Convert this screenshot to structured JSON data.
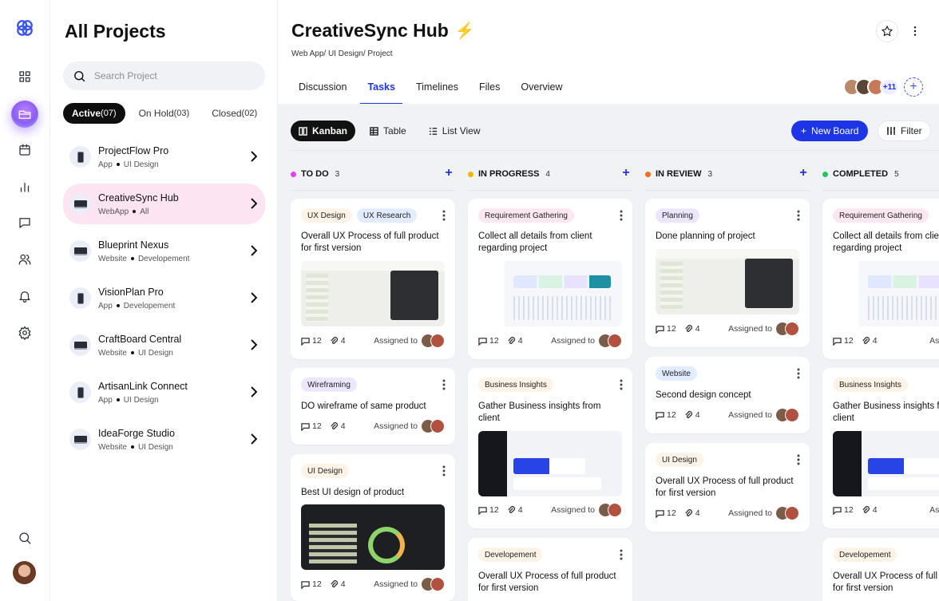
{
  "projects": {
    "title": "All Projects",
    "search_placeholder": "Search Project",
    "tabs": [
      {
        "label": "Active",
        "count": "(07)"
      },
      {
        "label": "On Hold",
        "count": "(03)"
      },
      {
        "label": "Closed",
        "count": "(02)"
      }
    ],
    "items": [
      {
        "name": "ProjectFlow Pro",
        "type": "App",
        "tag": "UI Design"
      },
      {
        "name": "CreativeSync Hub",
        "type": "WebApp",
        "tag": "All"
      },
      {
        "name": "Blueprint Nexus",
        "type": "Website",
        "tag": "Developement"
      },
      {
        "name": "VisionPlan Pro",
        "type": "App",
        "tag": "Developement"
      },
      {
        "name": "CraftBoard Central",
        "type": "Website",
        "tag": "UI Design"
      },
      {
        "name": "ArtisanLink Connect",
        "type": "App",
        "tag": "UI Design"
      },
      {
        "name": "IdeaForge Studio",
        "type": "Website",
        "tag": "UI Design"
      }
    ]
  },
  "header": {
    "title": "CreativeSync Hub",
    "breadcrumb": "Web App/ UI Design/ Project",
    "tabs": [
      "Discussion",
      "Tasks",
      "Timelines",
      "Files",
      "Overview"
    ],
    "members_more": "+11"
  },
  "toolbar": {
    "views": [
      "Kanban",
      "Table",
      "List View"
    ],
    "new_board": "New Board",
    "filter": "Filter"
  },
  "columns": [
    {
      "name": "TO DO",
      "count": "3",
      "color": "#e040fb"
    },
    {
      "name": "IN PROGRESS",
      "count": "4",
      "color": "#f5b301"
    },
    {
      "name": "IN REVIEW",
      "count": "3",
      "color": "#f26b1d"
    },
    {
      "name": "COMPLETED",
      "count": "5",
      "color": "#22c55e"
    }
  ],
  "cards": [
    {
      "tags": [
        "UX Design",
        "UX Research"
      ],
      "title": "Overall UX Process of full product for first version",
      "comments": "12",
      "attachments": "4",
      "assigned": "Assigned to"
    },
    {
      "tags": [
        "Wireframing"
      ],
      "title": "DO wireframe of same product",
      "comments": "12",
      "attachments": "4",
      "assigned": "Assigned to"
    },
    {
      "tags": [
        "UI Design"
      ],
      "title": "Best UI design of product",
      "comments": "12",
      "attachments": "4",
      "assigned": "Assigned to"
    },
    {
      "tags": [
        "Requirement Gathering"
      ],
      "title": "Collect all details from client regarding project",
      "comments": "12",
      "attachments": "4",
      "assigned": "Assigned to"
    },
    {
      "tags": [
        "Business Insights"
      ],
      "title": "Gather Business insights from client",
      "comments": "12",
      "attachments": "4",
      "assigned": "Assigned to"
    },
    {
      "tags": [
        "Developement"
      ],
      "title": "Overall UX Process of full product for first version"
    },
    {
      "tags": [
        "Planning"
      ],
      "title": "Done planning of project",
      "comments": "12",
      "attachments": "4",
      "assigned": "Assigned to"
    },
    {
      "tags": [
        "Website"
      ],
      "title": "Second design concept",
      "comments": "12",
      "attachments": "4",
      "assigned": "Assigned to"
    },
    {
      "tags": [
        "UI Design"
      ],
      "title": "Overall UX Process of full product for first version",
      "comments": "12",
      "attachments": "4",
      "assigned": "Assigned to"
    },
    {
      "tags": [
        "Requirement Gathering"
      ],
      "title": "Collect all details from client regarding project",
      "comments": "12",
      "attachments": "4",
      "assigned": "Assigned to"
    },
    {
      "tags": [
        "Business Insights"
      ],
      "title": "Gather Business insights from client",
      "comments": "12",
      "attachments": "4",
      "assigned": "Assigned to"
    },
    {
      "tags": [
        "Developement"
      ],
      "title": "Overall UX Process of full product for first version"
    }
  ],
  "colors": {
    "accent": "#1d35e6",
    "active_project": "#fce4f3",
    "tag_ux": "#fdf3e6",
    "tag_research": "#e2ecff",
    "tag_req": "#fde8f1",
    "tag_plan": "#ece6ff",
    "tag_wire": "#ece6ff",
    "tag_web": "#e2ecff",
    "tag_biz": "#fdf3e6"
  }
}
